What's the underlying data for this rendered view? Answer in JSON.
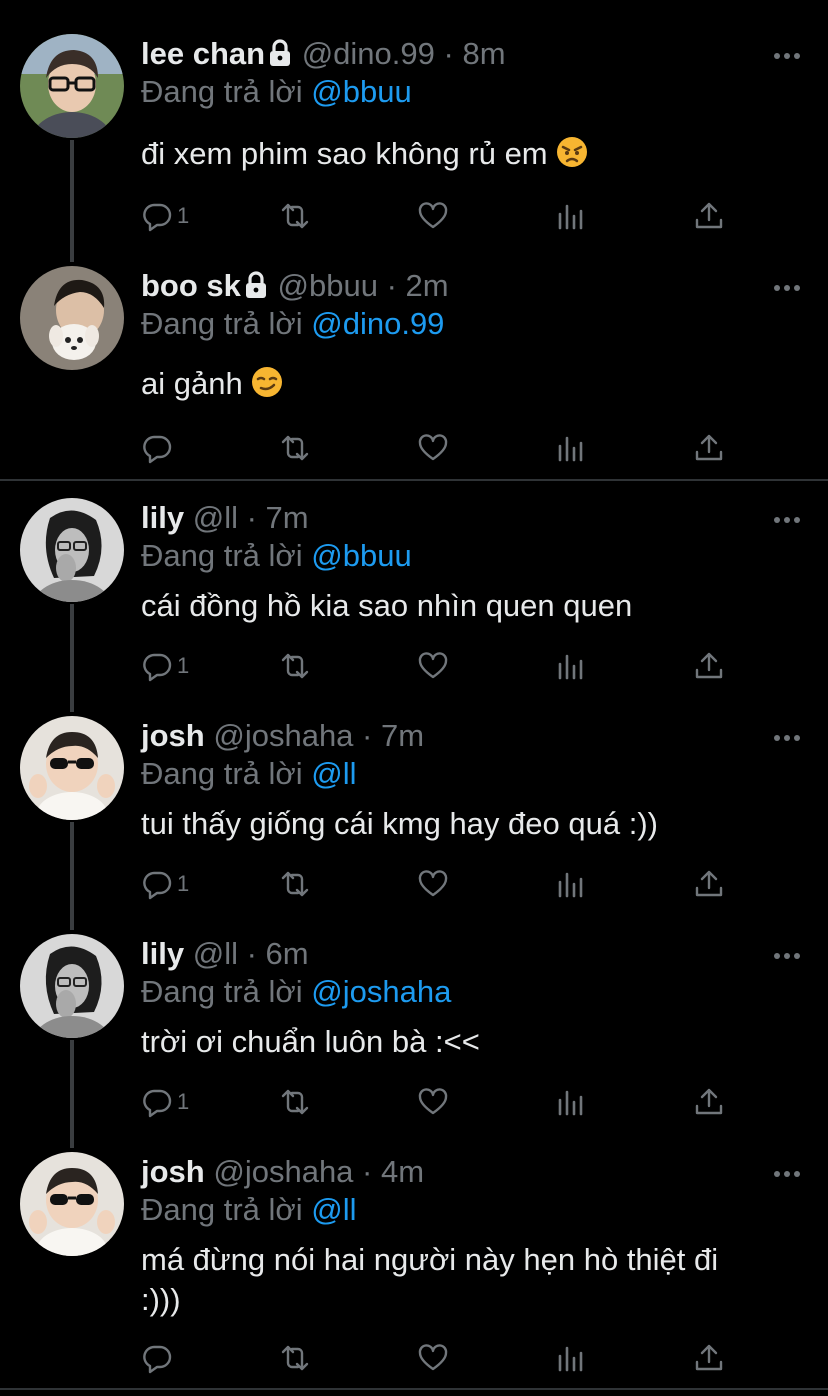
{
  "colors": {
    "background": "#000000",
    "text": "#e7e9ea",
    "muted": "#71767b",
    "link": "#1d9bf0",
    "divider": "#2f3336"
  },
  "reply_prefix": "Đang trả lời",
  "tweets": [
    {
      "name": "lee chan",
      "locked": true,
      "handle": "@dino.99",
      "dot": "·",
      "time": "8m",
      "reply_to": "@bbuu",
      "text": "đi xem phim sao không rủ em",
      "emoji": "angry-face",
      "reply_count": "1"
    },
    {
      "name": "boo sk",
      "locked": true,
      "handle": "@bbuu",
      "dot": "·",
      "time": "2m",
      "reply_to": "@dino.99",
      "text": "ai gảnh",
      "emoji": "smirk-face",
      "reply_count": ""
    },
    {
      "name": "lily",
      "locked": false,
      "handle": "@ll",
      "dot": "·",
      "time": "7m",
      "reply_to": "@bbuu",
      "text": "cái đồng hồ kia sao nhìn quen quen",
      "emoji": "",
      "reply_count": "1"
    },
    {
      "name": "josh",
      "locked": false,
      "handle": "@joshaha",
      "dot": "·",
      "time": "7m",
      "reply_to": "@ll",
      "text": "tui thấy giống cái kmg hay đeo quá :))",
      "emoji": "",
      "reply_count": "1"
    },
    {
      "name": "lily",
      "locked": false,
      "handle": "@ll",
      "dot": "·",
      "time": "6m",
      "reply_to": "@joshaha",
      "text": "trời ơi chuẩn luôn bà :<<",
      "emoji": "",
      "reply_count": "1"
    },
    {
      "name": "josh",
      "locked": false,
      "handle": "@joshaha",
      "dot": "·",
      "time": "4m",
      "reply_to": "@ll",
      "text": "má đừng nói hai người này hẹn hò thiệt đi :)))",
      "emoji": "",
      "reply_count": ""
    }
  ]
}
